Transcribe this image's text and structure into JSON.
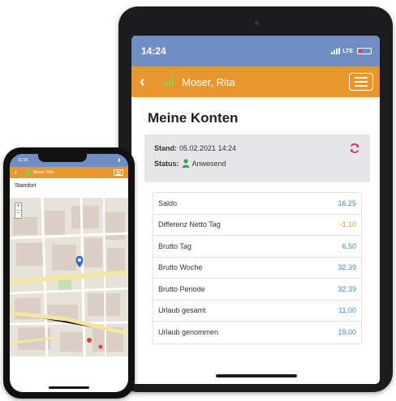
{
  "tablet": {
    "time": "14:24",
    "network": "LTE",
    "battery_level": 0.3,
    "user_name": "Moser, Rita",
    "page_title": "Meine Konten",
    "stand_label": "Stand:",
    "stand_value": "05.02.2021 14:24",
    "status_label": "Status:",
    "status_value": "Anwesend",
    "konten": [
      {
        "label": "Saldo",
        "value": "16.25"
      },
      {
        "label": "Differenz Netto Tag",
        "value": "-1.10"
      },
      {
        "label": "Brutto Tag",
        "value": "6.50"
      },
      {
        "label": "Brutto Woche",
        "value": "32.39"
      },
      {
        "label": "Brutto Periode",
        "value": "32.39"
      },
      {
        "label": "Urlaub gesamt",
        "value": "11,00"
      },
      {
        "label": "Urlaub genommen",
        "value": "19,00"
      }
    ]
  },
  "phone": {
    "time": "11:58",
    "user_name": "Moser, Rita",
    "page_title": "Standort",
    "zoom_in": "+",
    "zoom_out": "−"
  },
  "colors": {
    "status_bar": "#6f8fc4",
    "header": "#e8962e",
    "value_blue": "#4a86c8",
    "value_negative": "#e8962e",
    "refresh": "#d0306a",
    "status_green": "#3aa655"
  },
  "icons": [
    "back-icon",
    "signal-icon",
    "menu-icon",
    "refresh-icon",
    "person-icon",
    "map-pin-icon",
    "battery-icon"
  ]
}
